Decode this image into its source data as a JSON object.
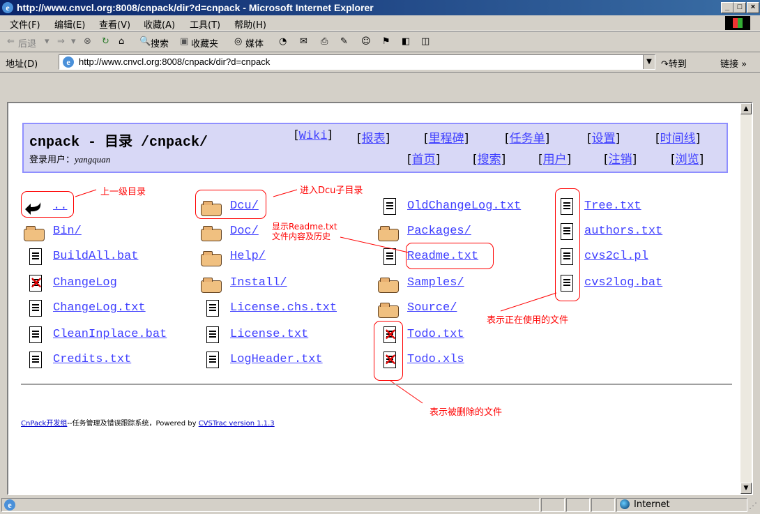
{
  "window": {
    "title": "http://www.cnvcl.org:8008/cnpack/dir?d=cnpack - Microsoft Internet Explorer",
    "min": "_",
    "max": "□",
    "close": "×"
  },
  "menu": {
    "items": [
      "文件(F)",
      "编辑(E)",
      "查看(V)",
      "收藏(A)",
      "工具(T)",
      "帮助(H)"
    ]
  },
  "toolbar": {
    "back": "后退",
    "search": "搜索",
    "favorites": "收藏夹",
    "media": "媒体"
  },
  "address": {
    "label": "地址(D)",
    "url": "http://www.cnvcl.org:8008/cnpack/dir?d=cnpack",
    "go": "转到",
    "links": "链接"
  },
  "header": {
    "title": "cnpack - 目录 /cnpack/",
    "login_label": "登录用户：",
    "login_user": "yangquan",
    "nav_row1": [
      "Wiki",
      "报表",
      "里程碑",
      "任务单",
      "设置",
      "时间线"
    ],
    "nav_row2": [
      "首页",
      "搜索",
      "用户",
      "注销",
      "浏览"
    ]
  },
  "files": {
    "col1": [
      {
        "name": "..",
        "type": "up"
      },
      {
        "name": "Bin/",
        "type": "folder"
      },
      {
        "name": "BuildAll.bat",
        "type": "file"
      },
      {
        "name": "ChangeLog",
        "type": "deleted"
      },
      {
        "name": "ChangeLog.txt",
        "type": "file"
      },
      {
        "name": "CleanInplace.bat",
        "type": "file"
      },
      {
        "name": "Credits.txt",
        "type": "file"
      }
    ],
    "col2": [
      {
        "name": "Dcu/",
        "type": "folder"
      },
      {
        "name": "Doc/",
        "type": "folder"
      },
      {
        "name": "Help/",
        "type": "folder"
      },
      {
        "name": "Install/",
        "type": "folder"
      },
      {
        "name": "License.chs.txt",
        "type": "file"
      },
      {
        "name": "License.txt",
        "type": "file"
      },
      {
        "name": "LogHeader.txt",
        "type": "file"
      }
    ],
    "col3": [
      {
        "name": "OldChangeLog.txt",
        "type": "file"
      },
      {
        "name": "Packages/",
        "type": "folder"
      },
      {
        "name": "Readme.txt",
        "type": "file"
      },
      {
        "name": "Samples/",
        "type": "folder"
      },
      {
        "name": "Source/",
        "type": "folder"
      },
      {
        "name": "Todo.txt",
        "type": "deleted"
      },
      {
        "name": "Todo.xls",
        "type": "deleted"
      }
    ],
    "col4": [
      {
        "name": "Tree.txt",
        "type": "file"
      },
      {
        "name": "authors.txt",
        "type": "file"
      },
      {
        "name": "cvs2cl.pl",
        "type": "file"
      },
      {
        "name": "cvs2log.bat",
        "type": "file"
      }
    ]
  },
  "annotations": {
    "up": "上一级目录",
    "dcu": "进入Dcu子目录",
    "readme_1": "显示Readme.txt",
    "readme_2": "文件内容及历史",
    "in_use": "表示正在使用的文件",
    "deleted": "表示被删除的文件"
  },
  "footer": {
    "link1": "CnPack开发组",
    "mid": "--任务管理及错误跟踪系统，Powered by ",
    "link2": "CVSTrac version 1.1.3"
  },
  "status": {
    "zone": "Internet"
  },
  "colors": {
    "link": "#4040ff",
    "header_bg": "#d8d8f6",
    "header_border": "#8f8fff",
    "annotation": "#ff0000"
  }
}
